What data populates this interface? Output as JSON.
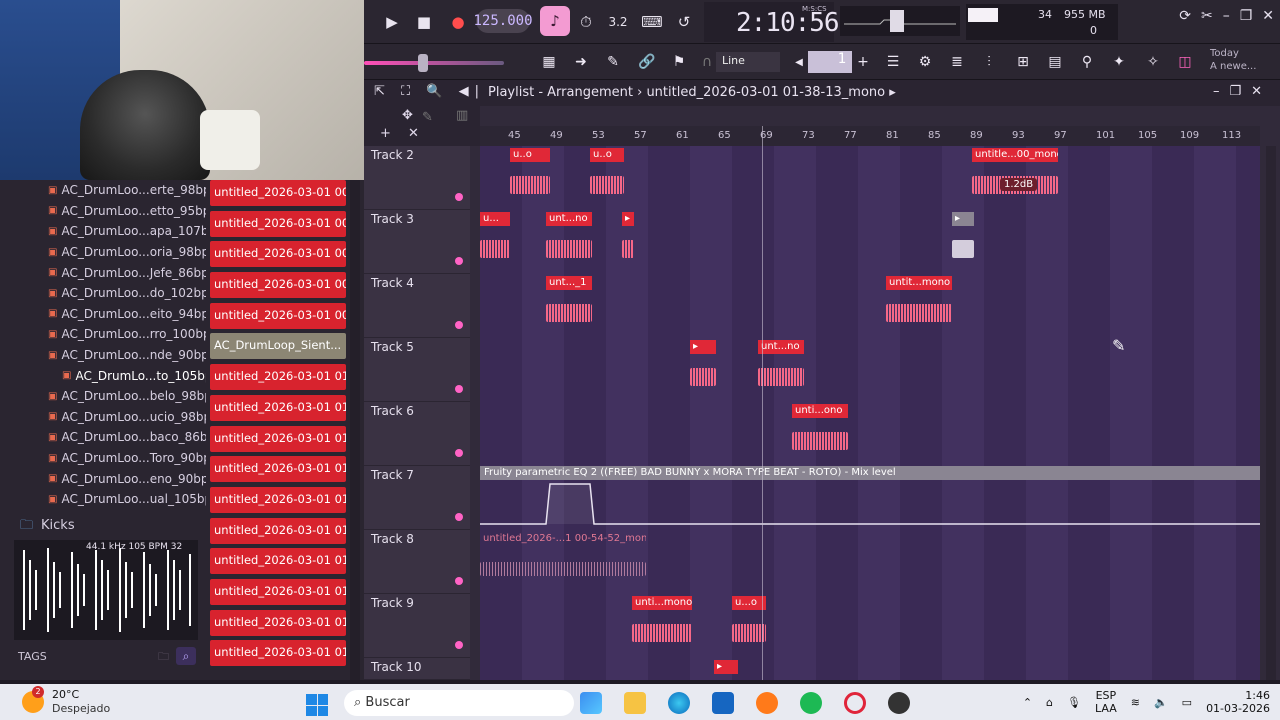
{
  "topbar": {
    "tempo": "125.000",
    "time": "2:10:56",
    "time_label": "M:S:CS",
    "cpu_value": "34",
    "ram_value": "955 MB",
    "poly_value": "0",
    "step_value": "3.2"
  },
  "toolbar2": {
    "snap": "Line",
    "pattern_num": "1",
    "news_title": "Today",
    "news_text": "A newe..."
  },
  "playlist": {
    "icons": "⇱ ⛶ 🔍 ◀|",
    "title": "Playlist - Arrangement",
    "project": "untitled_2026-03-01 01-38-13_mono",
    "ruler": [
      "45",
      "49",
      "53",
      "57",
      "61",
      "65",
      "69",
      "73",
      "77",
      "81",
      "85",
      "89",
      "93",
      "97",
      "101",
      "105",
      "109",
      "113"
    ],
    "tracks": [
      "Track 2",
      "Track 3",
      "Track 4",
      "Track 5",
      "Track 6",
      "Track 7",
      "Track 8",
      "Track 9",
      "Track 10"
    ],
    "clips": {
      "t2a": "u..o",
      "t2b": "u..o",
      "t2c": "untitle...00_mono",
      "t3a": "u...",
      "t3b": "unt...no",
      "t4a": "unt..._1",
      "t4b": "untit...mono",
      "t5b": "unt...no",
      "t6a": "unti...ono",
      "t8a": "untitled_2026-...1 00-54-52_mono",
      "t9a": "unti...mono",
      "t9b": "u...o"
    },
    "automation": "Fruity parametric EQ 2 ((FREE) BAD BUNNY x MORA TYPE BEAT - ROTO) - Mix level",
    "volume_badge": "1.2dB"
  },
  "browser": {
    "items": [
      "AC_DrumLoo...erte_98bpm",
      "AC_DrumLoo...etto_95bpm",
      "AC_DrumLoo...apa_107bpm",
      "AC_DrumLoo...oria_98bpm",
      "AC_DrumLoo...Jefe_86bpm",
      "AC_DrumLoo...do_102bpm",
      "AC_DrumLoo...eito_94bpm",
      "AC_DrumLoo...rro_100bpm",
      "AC_DrumLoo...nde_90bpm",
      "AC_DrumLo...to_105bpm",
      "AC_DrumLoo...belo_98bpm",
      "AC_DrumLoo...ucio_98bpm",
      "AC_DrumLoo...baco_86bpm",
      "AC_DrumLoo...Toro_90bpm",
      "AC_DrumLoo...eno_90bpm",
      "AC_DrumLoo...ual_105bpm"
    ],
    "folder": "Kicks",
    "wave_info": "44.1 kHz 105 BPM 32",
    "tags": "TAGS"
  },
  "channels": [
    "untitled_2026-03-01 00...",
    "untitled_2026-03-01 00...",
    "untitled_2026-03-01 00...",
    "untitled_2026-03-01 00...",
    "untitled_2026-03-01 00...",
    "AC_DrumLoop_Sient...",
    "untitled_2026-03-01 01...",
    "untitled_2026-03-01 01...",
    "untitled_2026-03-01 01...",
    "untitled_2026-03-01 01...",
    "untitled_2026-03-01 01...",
    "untitled_2026-03-01 01...",
    "untitled_2026-03-01 01...",
    "untitled_2026-03-01 01...",
    "untitled_2026-03-01 01...",
    "untitled_2026-03-01 01..."
  ],
  "taskbar": {
    "weather_temp": "20°C",
    "weather_desc": "Despejado",
    "weather_badge": "2",
    "search": "Buscar",
    "lang1": "ESP",
    "lang2": "LAA",
    "time": "1:46",
    "date": "01-03-2026"
  },
  "colors": {
    "clip_header": "#e02837",
    "clip_wave": "#ff6b8a",
    "accent_pink": "#ff4fb7",
    "taskbar_bg": "#e8eaf1"
  }
}
